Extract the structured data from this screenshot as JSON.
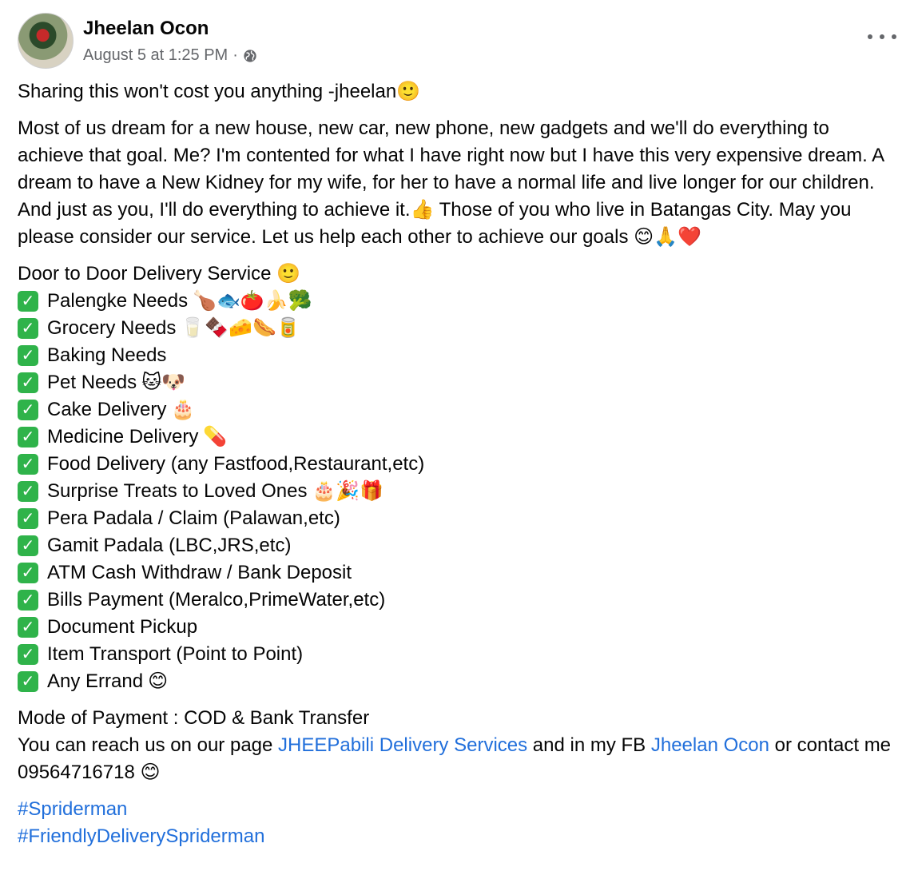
{
  "post": {
    "author": "Jheelan Ocon",
    "timestamp": "August 5 at 1:25 PM",
    "meta_separator": "·",
    "privacy_icon": "globe-icon",
    "more_icon": "more-options-icon"
  },
  "body": {
    "intro": "Sharing this won't cost you anything -jheelan🙂",
    "story": "Most of us dream for a new house, new car, new phone, new gadgets and we'll do everything to achieve that goal. Me? I'm contented for what I have right now but I have this very expensive dream. A dream to have a New Kidney for my wife, for her to have a normal life and live longer for our children. And just as you, I'll do everything to achieve it.👍 Those of you who live in Batangas City. May you please consider our service. Let us help each other to achieve our goals 😊🙏❤️",
    "service_title": "Door to Door Delivery Service 🙂",
    "check_glyph": "✓",
    "services": [
      {
        "label": "Palengke Needs",
        "emoji": "🍗🐟🍅🍌🥦"
      },
      {
        "label": "Grocery Needs",
        "emoji": "🥛🍫🧀🌭🥫"
      },
      {
        "label": "Baking Needs",
        "emoji": ""
      },
      {
        "label": "Pet Needs",
        "emoji": "🐱🐶"
      },
      {
        "label": "Cake Delivery",
        "emoji": "🎂"
      },
      {
        "label": "Medicine Delivery",
        "emoji": "💊"
      },
      {
        "label": "Food Delivery (any Fastfood,Restaurant,etc)",
        "emoji": ""
      },
      {
        "label": "Surprise Treats to Loved Ones",
        "emoji": "🎂🎉🎁"
      },
      {
        "label": "Pera Padala / Claim (Palawan,etc)",
        "emoji": ""
      },
      {
        "label": "Gamit Padala (LBC,JRS,etc)",
        "emoji": ""
      },
      {
        "label": "ATM Cash Withdraw / Bank Deposit",
        "emoji": ""
      },
      {
        "label": "Bills Payment (Meralco,PrimeWater,etc)",
        "emoji": ""
      },
      {
        "label": "Document Pickup",
        "emoji": ""
      },
      {
        "label": "Item Transport (Point to Point)",
        "emoji": ""
      },
      {
        "label": "Any Errand",
        "emoji": "😊"
      }
    ],
    "payment": "Mode of Payment : COD & Bank Transfer",
    "contact_prefix": "You can reach us on our page ",
    "page_link": "JHEEPabili Delivery Services",
    "contact_middle": " and in my FB ",
    "profile_link": "Jheelan Ocon",
    "contact_suffix": " or contact me 09564716718 😊",
    "hashtags": [
      "#Spriderman",
      "#FriendlyDeliverySpriderman"
    ]
  },
  "colors": {
    "link": "#216fdb",
    "meta_text": "#65676b",
    "check_green": "#2fb34a"
  }
}
